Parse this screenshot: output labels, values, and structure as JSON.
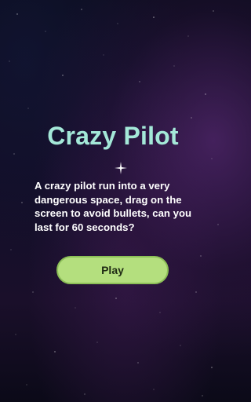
{
  "game": {
    "title": "Crazy Pilot",
    "description": "A crazy pilot run into a very dangerous space, drag on the screen to avoid bullets, can you last for 60 seconds?",
    "play_label": "Play"
  },
  "colors": {
    "title": "#a4e8d8",
    "button_bg": "#b4df7e",
    "button_border": "#8cbf57",
    "button_text": "#1f2a14",
    "description_text": "#ffffff"
  },
  "icons": {
    "sparkle": "sparkle-icon"
  }
}
